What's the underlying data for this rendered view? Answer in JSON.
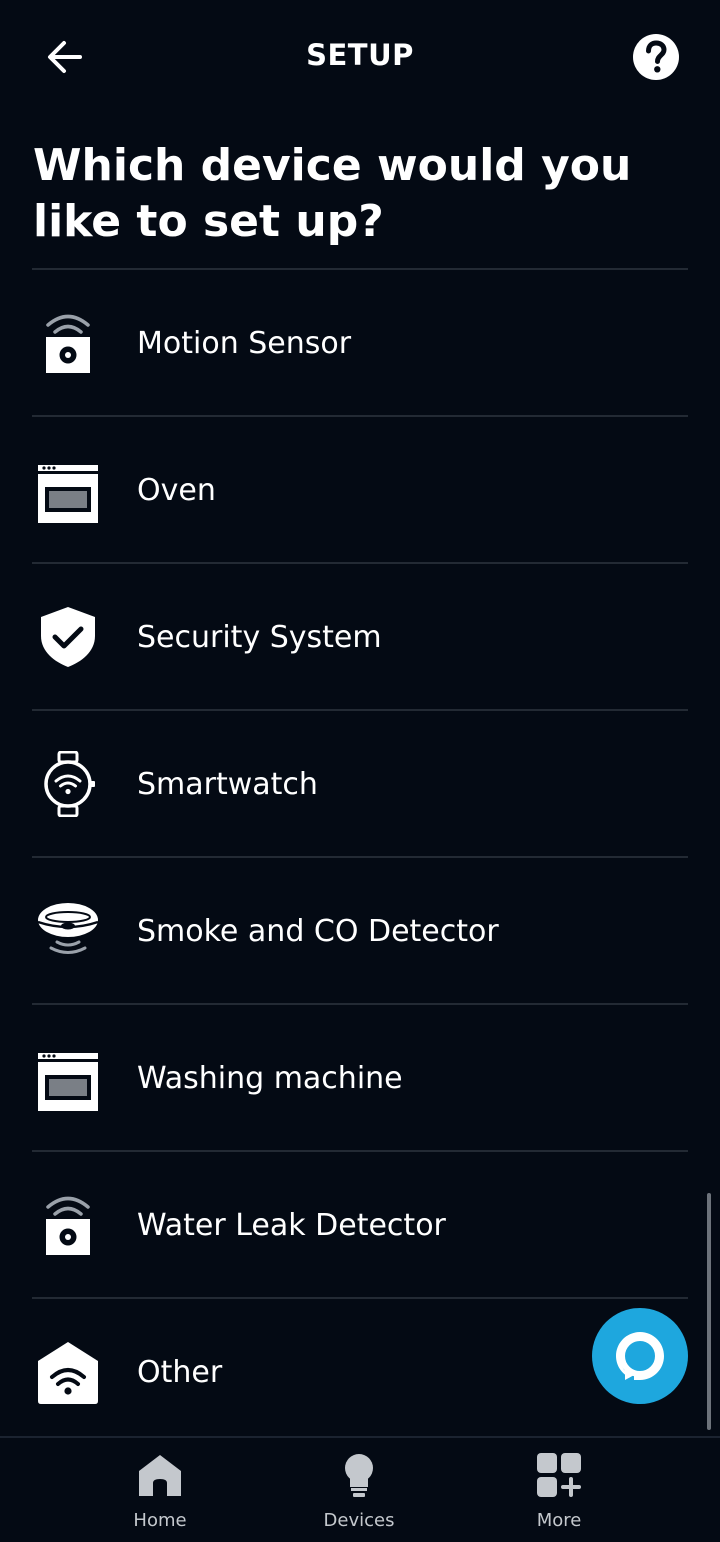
{
  "header": {
    "title": "SETUP",
    "back_icon": "arrow-left-icon",
    "help_icon": "question-mark-icon"
  },
  "page": {
    "title": "Which device would you like to set up?"
  },
  "devices": [
    {
      "label": "Motion Sensor",
      "icon": "motion-sensor-icon"
    },
    {
      "label": "Oven",
      "icon": "oven-icon"
    },
    {
      "label": "Security System",
      "icon": "shield-check-icon"
    },
    {
      "label": "Smartwatch",
      "icon": "smartwatch-icon"
    },
    {
      "label": "Smoke and CO Detector",
      "icon": "smoke-detector-icon"
    },
    {
      "label": "Washing machine",
      "icon": "washing-machine-icon"
    },
    {
      "label": "Water Leak Detector",
      "icon": "water-leak-sensor-icon"
    },
    {
      "label": "Other",
      "icon": "house-wifi-icon"
    }
  ],
  "fab": {
    "icon": "alexa-icon"
  },
  "bottom_nav": [
    {
      "label": "Home",
      "icon": "home-icon"
    },
    {
      "label": "Devices",
      "icon": "lightbulb-icon"
    },
    {
      "label": "More",
      "icon": "grid-plus-icon"
    }
  ],
  "colors": {
    "background": "#040a14",
    "divider": "#232a34",
    "accent": "#1ea7de",
    "nav_text": "#c4c8cd"
  }
}
